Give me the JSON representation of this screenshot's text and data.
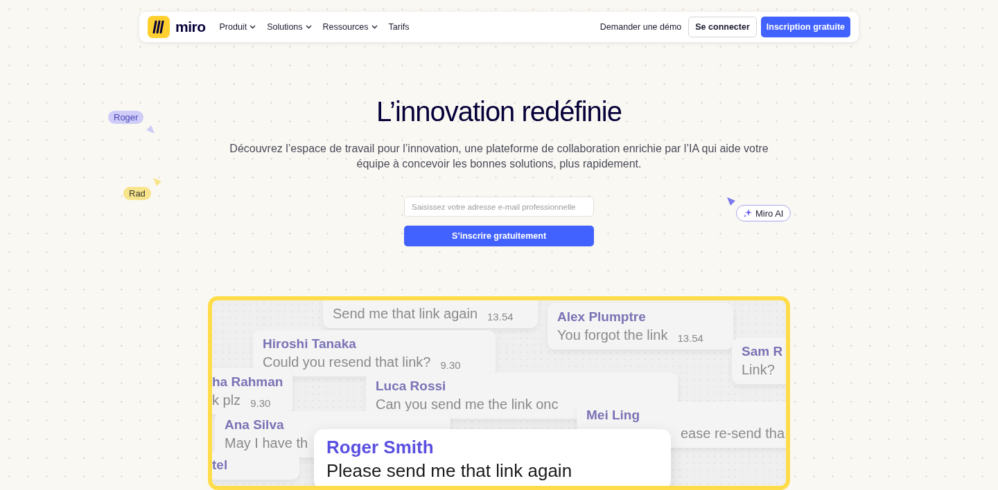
{
  "nav": {
    "logo": "miro",
    "items": [
      {
        "label": "Produit",
        "dropdown": true
      },
      {
        "label": "Solutions",
        "dropdown": true
      },
      {
        "label": "Ressources",
        "dropdown": true
      },
      {
        "label": "Tarifs",
        "dropdown": false
      }
    ],
    "demo_link": "Demander une démo",
    "login_button": "Se connecter",
    "signup_button": "Inscription gratuite"
  },
  "hero": {
    "title": "L’innovation redéfinie",
    "subtitle": "Découvrez l’espace de travail pour l’innovation, une plateforme de collaboration enrichie par l’IA qui aide votre équipe à concevoir les bonnes solutions, plus rapidement.",
    "email": {
      "placeholder": "Saisissez votre adresse e-mail professionnelle"
    },
    "cta": "S’inscrire gratuitement"
  },
  "cursors": [
    {
      "label": "Roger",
      "color": "#cfcdf8"
    },
    {
      "label": "Rad",
      "color": "#f8e48c"
    }
  ],
  "ai_chip": "Miro AI",
  "chat": [
    {
      "kind": "bubble",
      "message": "Send me that link again",
      "time": "13.54"
    },
    {
      "kind": "bubble",
      "name": "Alex Plumptre",
      "message": "You forgot the link",
      "time": "13.54"
    },
    {
      "kind": "bubble",
      "name": "Hiroshi Tanaka",
      "message": "Could you resend that link?",
      "time": "9.30"
    },
    {
      "kind": "bubble",
      "name": "Sam R",
      "message": "Link?"
    },
    {
      "kind": "bubble",
      "name": "ha Rahman",
      "message": "k plz",
      "time": "9.30"
    },
    {
      "kind": "bubble",
      "name": "Luca Rossi",
      "message": "Can you send me the link onc"
    },
    {
      "kind": "bubble",
      "name": "Ana Silva",
      "message": "May I have th"
    },
    {
      "kind": "bubble",
      "name": "Mei Ling",
      "message": "ease re-send tha"
    },
    {
      "kind": "bubble",
      "name": "tel"
    },
    {
      "kind": "featured",
      "name": "Roger Smith",
      "message": "Please send me that link again"
    }
  ]
}
